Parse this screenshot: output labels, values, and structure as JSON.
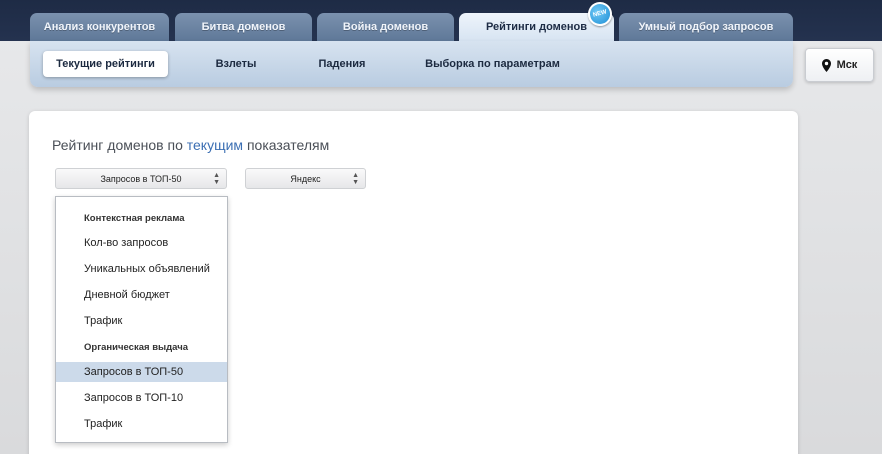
{
  "top_tabs": [
    {
      "label": "Анализ конкурентов"
    },
    {
      "label": "Битва доменов"
    },
    {
      "label": "Война доменов"
    },
    {
      "label": "Рейтинги доменов",
      "active": true
    },
    {
      "label": "Умный подбор запросов"
    }
  ],
  "new_badge": "NEW",
  "sub_tabs": [
    {
      "label": "Текущие рейтинги",
      "active": true
    },
    {
      "label": "Взлеты"
    },
    {
      "label": "Падения"
    },
    {
      "label": "Выборка по параметрам"
    }
  ],
  "city": {
    "label": "Мск",
    "icon": "map-pin-icon"
  },
  "heading": {
    "part1": "Рейтинг доменов по ",
    "highlight": "текущим",
    "part2": " показателям"
  },
  "metric_select": {
    "value": "Запросов в ТОП-50"
  },
  "engine_select": {
    "value": "Яндекс"
  },
  "dropdown": {
    "items": [
      {
        "label": "Контекстная реклама",
        "group": true
      },
      {
        "label": "Кол-во запросов"
      },
      {
        "label": "Уникальных объявлений"
      },
      {
        "label": "Дневной бюджет"
      },
      {
        "label": "Трафик"
      },
      {
        "label": "Органическая выдача",
        "group": true
      },
      {
        "label": "Запросов в ТОП-50",
        "selected": true
      },
      {
        "label": "Запросов в ТОП-10"
      },
      {
        "label": "Трафик"
      }
    ]
  },
  "colors": {
    "topbar": "#1e2b45",
    "tab": "#6a83a3",
    "accent": "#3c6fb3",
    "selected": "#ccdaea"
  }
}
